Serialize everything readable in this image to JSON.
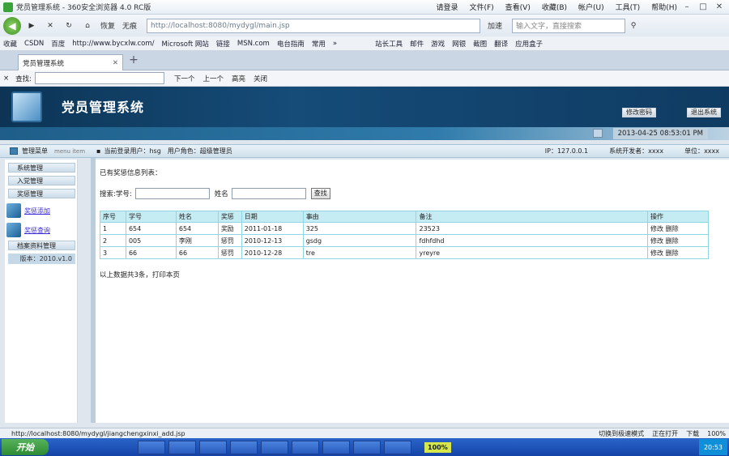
{
  "browser": {
    "window_title": "党员管理系统 - 360安全浏览器 4.0 RC版",
    "menu": [
      "请登录",
      "文件(F)",
      "查看(V)",
      "收藏(B)",
      "帐户(U)",
      "工具(T)",
      "帮助(H)"
    ],
    "nav": {
      "back": "◀",
      "forward": "▶",
      "stop": "✕",
      "refresh": "↻",
      "home": "⌂",
      "restore": "恢复",
      "noneimg": "无痕"
    },
    "address": "http://localhost:8080/mydygl/main.jsp",
    "accelerate": "加速",
    "search_placeholder": "输入文字，直接搜索",
    "favorites": [
      "收藏",
      "CSDN",
      "百度",
      "http://www.bycxlw.com/",
      "Microsoft 网站",
      "链接",
      "MSN.com",
      "电台指南",
      "常用",
      "»",
      "站长工具",
      "邮件",
      "游戏",
      "网银",
      "截图",
      "翻译",
      "应用盒子"
    ],
    "tab_title": "党员管理系统",
    "find": {
      "close": "×",
      "label": "查找:",
      "next": "下一个",
      "prev": "上一个",
      "highlight": "高亮",
      "closebtn": "关闭"
    }
  },
  "app": {
    "system_title": "党员管理系统",
    "change_password": "修改密码",
    "logout": "退出系统",
    "datetime": "2013-04-25 08:53:01 PM",
    "menu_title": "管理菜单",
    "menu_sub": "menu item",
    "current_user_label": "当前登录用户：",
    "current_user": "hsg",
    "role_label": "用户角色：",
    "role": "超级管理员",
    "ip_label": "IP：",
    "ip": "127.0.0.1",
    "developer_label": "系统开发者：",
    "developer": "xxxx",
    "unit_label": "单位：",
    "unit": "xxxx"
  },
  "sidebar": {
    "items": [
      "系统管理",
      "入党管理",
      "奖惩管理"
    ],
    "links": [
      "奖惩添加",
      "奖惩查询"
    ],
    "archive": "档案资料管理",
    "version": "版本：2010.v1.0"
  },
  "main": {
    "list_title": "已有奖惩信息列表：",
    "search_label": "搜索:学号:",
    "name_label": "姓名",
    "search_button": "查找",
    "columns": [
      "序号",
      "学号",
      "姓名",
      "奖惩",
      "日期",
      "事由",
      "备注",
      "操作"
    ],
    "rows": [
      [
        "1",
        "654",
        "654",
        "奖励",
        "2011-01-18",
        "325",
        "23523",
        "修改 删除"
      ],
      [
        "2",
        "005",
        "李刚",
        "惩罚",
        "2010-12-13",
        "gsdg",
        "fdhfdhd",
        "修改 删除"
      ],
      [
        "3",
        "66",
        "66",
        "惩罚",
        "2010-12-28",
        "tre",
        "yreyre",
        "修改 删除"
      ]
    ],
    "footer": "以上数据共3条，打印本页"
  },
  "status": {
    "url": "http://localhost:8080/mydygl/jiangchengxinxi_add.jsp",
    "mode": "切换到极速模式",
    "compat": "正在打开",
    "download": "下载",
    "zoom": "100%"
  },
  "taskbar": {
    "start": "开始",
    "time": "20:53",
    "battery": "100%"
  }
}
